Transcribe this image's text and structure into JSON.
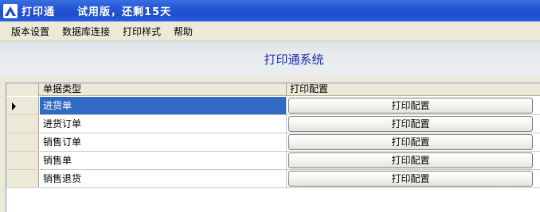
{
  "window": {
    "app_title": "打印通",
    "status_text": "试用版，还剩15天",
    "icon": "app-logo-icon"
  },
  "menu": [
    {
      "label": "版本设置"
    },
    {
      "label": "数据库连接"
    },
    {
      "label": "打印样式"
    },
    {
      "label": "帮助"
    }
  ],
  "header": {
    "title": "打印通系统"
  },
  "grid": {
    "columns": [
      "单据类型",
      "打印配置"
    ],
    "selected_row": 0,
    "rows": [
      {
        "type": "进货单",
        "button": "打印配置"
      },
      {
        "type": "进货订单",
        "button": "打印配置"
      },
      {
        "type": "销售订单",
        "button": "打印配置"
      },
      {
        "type": "销售单",
        "button": "打印配置"
      },
      {
        "type": "销售退货",
        "button": "打印配置"
      }
    ]
  },
  "colors": {
    "titlebar": "#2456d6",
    "selection": "#316ac5",
    "header_title": "#1c2fa8",
    "window_bg": "#ece9d8"
  }
}
